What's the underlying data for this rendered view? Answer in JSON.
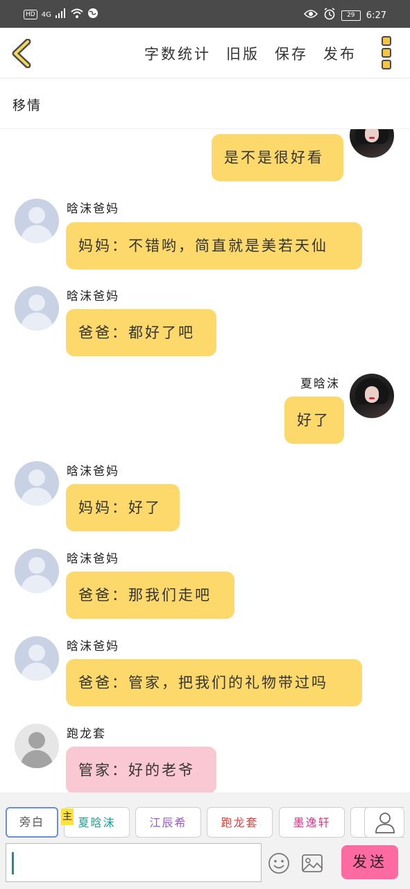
{
  "status": {
    "hd": "HD",
    "network": "4G",
    "battery": "29",
    "time": "6:27"
  },
  "toolbar": {
    "actions": [
      "字数统计",
      "旧版",
      "保存",
      "发布"
    ]
  },
  "chapter": {
    "title": "移情"
  },
  "messages": [
    {
      "side": "right",
      "name": "",
      "text": "是不是很好看",
      "avatar": "photo"
    },
    {
      "side": "left",
      "name": "晗沫爸妈",
      "text": "妈妈：不错哟，简直就是美若天仙",
      "avatar": "default"
    },
    {
      "side": "left",
      "name": "晗沫爸妈",
      "text": "爸爸：都好了吧",
      "avatar": "default"
    },
    {
      "side": "right",
      "name": "夏晗沫",
      "text": "好了",
      "avatar": "photo"
    },
    {
      "side": "left",
      "name": "晗沫爸妈",
      "text": "妈妈：好了",
      "avatar": "default"
    },
    {
      "side": "left",
      "name": "晗沫爸妈",
      "text": "爸爸：那我们走吧",
      "avatar": "default"
    },
    {
      "side": "left",
      "name": "晗沫爸妈",
      "text": "爸爸：管家，把我们的礼物带过吗",
      "avatar": "default"
    },
    {
      "side": "left",
      "name": "跑龙套",
      "text": "管家：好的老爷",
      "avatar": "grey",
      "color": "pink"
    }
  ],
  "roles": [
    {
      "label": "旁白",
      "color": "#555555"
    },
    {
      "label": "夏晗沫",
      "color": "#1aa39a"
    },
    {
      "label": "江辰希",
      "color": "#9b59c9"
    },
    {
      "label": "跑龙套",
      "color": "#e0433f"
    },
    {
      "label": "墨逸轩",
      "color": "#e0328a"
    }
  ],
  "main_badge": "主",
  "send_label": "发送"
}
